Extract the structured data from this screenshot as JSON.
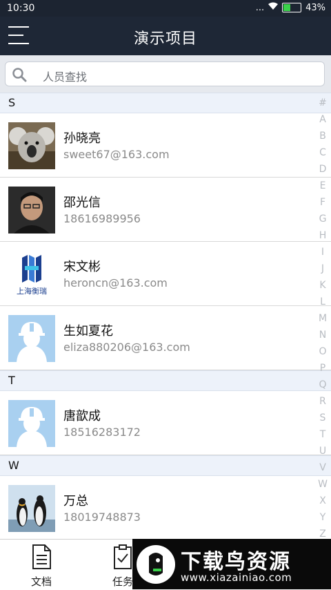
{
  "status": {
    "time": "10:30",
    "icons": "... ",
    "battery": "43%",
    "battery_level": 0.43
  },
  "header": {
    "title": "演示项目",
    "menu_icon": "hamburger-menu-icon"
  },
  "search": {
    "placeholder": "人员查找",
    "icon": "search-icon"
  },
  "sections": [
    {
      "letter": "S",
      "contacts": [
        {
          "name": "孙晓亮",
          "sub": "sweet67@163.com",
          "avatar": "koala-photo"
        },
        {
          "name": "邵光信",
          "sub": "18616989956",
          "avatar": "man-photo"
        },
        {
          "name": "宋文彬",
          "sub": "heroncn@163.com",
          "avatar": "company-logo",
          "logo_text": "上海衡瑞"
        },
        {
          "name": "生如夏花",
          "sub": "eliza880206@163.com",
          "avatar": "default-worker-avatar"
        }
      ]
    },
    {
      "letter": "T",
      "contacts": [
        {
          "name": "唐歆成",
          "sub": "18516283172",
          "avatar": "default-worker-avatar"
        }
      ]
    },
    {
      "letter": "W",
      "contacts": [
        {
          "name": "万总",
          "sub": "18019748873",
          "avatar": "penguins-photo"
        }
      ]
    }
  ],
  "index_letters": [
    "#",
    "A",
    "B",
    "C",
    "D",
    "E",
    "F",
    "G",
    "H",
    "I",
    "J",
    "K",
    "L",
    "M",
    "N",
    "O",
    "P",
    "Q",
    "R",
    "S",
    "T",
    "U",
    "V",
    "W",
    "X",
    "Y",
    "Z"
  ],
  "tabs": [
    {
      "label": "文档",
      "icon": "document-icon"
    },
    {
      "label": "任务",
      "icon": "task-clipboard-icon"
    }
  ],
  "watermark": {
    "title": "下载鸟资源",
    "url": "www.xiazainiao.com"
  },
  "colors": {
    "header": "#1e2736",
    "section": "#edf2fa",
    "avatar_default": "#a9d0f0"
  }
}
